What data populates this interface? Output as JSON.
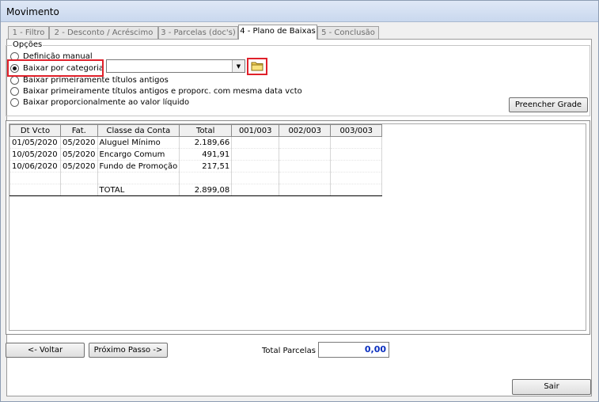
{
  "window": {
    "title": "Movimento"
  },
  "tabs": [
    {
      "label": "1 - Filtro"
    },
    {
      "label": "2 - Desconto / Acréscimo"
    },
    {
      "label": "3 - Parcelas (doc's)"
    },
    {
      "label": "4 - Plano de Baixas"
    },
    {
      "label": "5 - Conclusão"
    }
  ],
  "options": {
    "group_label": "Opções",
    "radios": [
      {
        "label": "Definição manual",
        "checked": false
      },
      {
        "label": "Baixar por categoria",
        "checked": true
      },
      {
        "label": "Baixar primeiramente títulos antigos",
        "checked": false
      },
      {
        "label": "Baixar primeiramente títulos antigos e proporc. com mesma data vcto",
        "checked": false
      },
      {
        "label": "Baixar proporcionalmente ao valor líquido",
        "checked": false
      }
    ],
    "category_select": {
      "value": ""
    },
    "fill_grid_button": "Preencher Grade"
  },
  "grid": {
    "columns": [
      "Dt Vcto",
      "Fat.",
      "Classe da Conta",
      "Total",
      "001/003",
      "002/003",
      "003/003"
    ],
    "rows": [
      [
        "01/05/2020",
        "05/2020",
        "Aluguel Mínimo",
        "2.189,66",
        "",
        "",
        ""
      ],
      [
        "10/05/2020",
        "05/2020",
        "Encargo Comum",
        "491,91",
        "",
        "",
        ""
      ],
      [
        "10/06/2020",
        "05/2020",
        "Fundo de Promoção",
        "217,51",
        "",
        "",
        ""
      ],
      [
        "",
        "",
        "",
        "",
        "",
        "",
        ""
      ],
      [
        "",
        "",
        "TOTAL",
        "2.899,08",
        "",
        "",
        ""
      ]
    ]
  },
  "footer": {
    "back_button": "<- Voltar",
    "next_button": "Próximo Passo ->",
    "total_label": "Total Parcelas",
    "total_value": "0,00",
    "exit_button": "Sair"
  },
  "colors": {
    "highlight": "#e0202a",
    "total_value": "#0a2fbf"
  },
  "icons": {
    "folder": "folder-icon",
    "combo_arrow": "chevron-down-icon"
  }
}
